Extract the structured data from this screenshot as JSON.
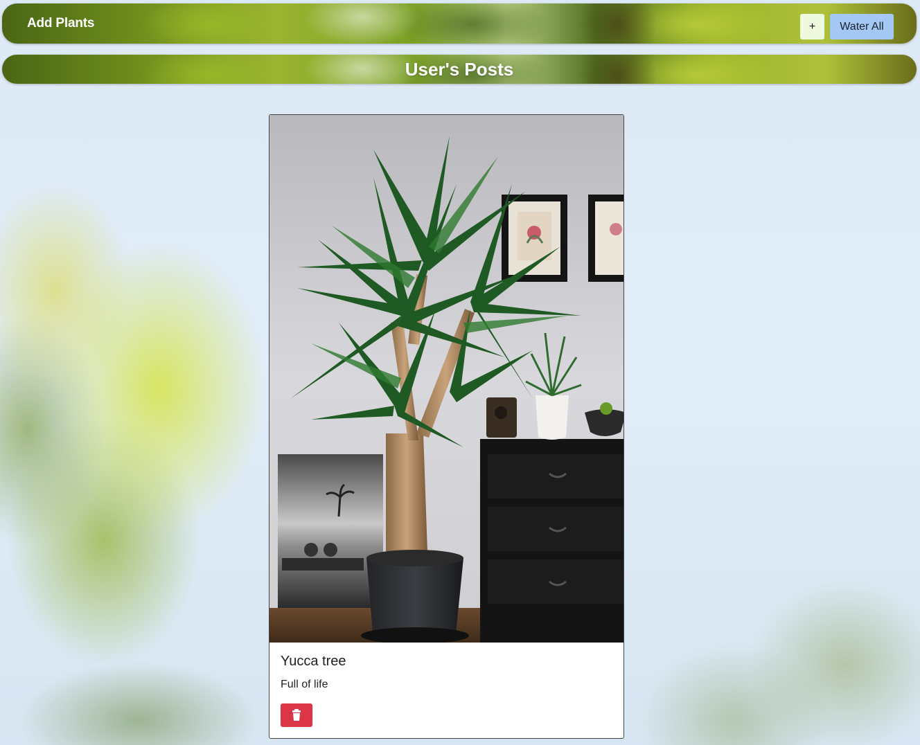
{
  "navbar": {
    "brand": "Add Plants",
    "add_button_label": "+",
    "water_all_label": "Water All"
  },
  "posts": {
    "heading": "User's Posts",
    "items": [
      {
        "title": "Yucca tree",
        "description": "Full of life",
        "delete_icon": "trash-icon"
      }
    ]
  },
  "colors": {
    "add_button_bg": "#eef9de",
    "water_button_bg": "#a4c8f3",
    "delete_button_bg": "#dc3545"
  }
}
